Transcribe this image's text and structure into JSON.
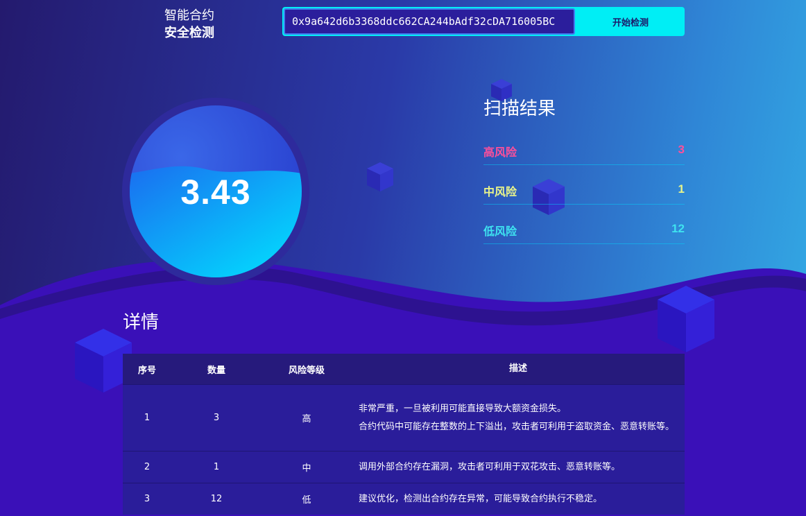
{
  "header": {
    "brand_line1": "智能合约",
    "brand_line2": "安全检测",
    "address_value": "0x9a642d6b3368ddc662CA244bAdf32cDA716005BC",
    "scan_button": "开始检测"
  },
  "score": {
    "value": "3.43"
  },
  "results": {
    "title": "扫描结果",
    "items": [
      {
        "label": "高风险",
        "count": "3",
        "color": "#ff4f9a"
      },
      {
        "label": "中风险",
        "count": "1",
        "color": "#e9f58a"
      },
      {
        "label": "低风险",
        "count": "12",
        "color": "#3ee3f0"
      }
    ]
  },
  "details": {
    "title": "详情",
    "columns": [
      "序号",
      "数量",
      "风险等级",
      "描述"
    ],
    "rows": [
      {
        "index": "1",
        "count": "3",
        "level": "高",
        "desc": [
          "非常严重，一旦被利用可能直接导致大额资金损失。",
          "合约代码中可能存在整数的上下溢出，攻击者可利用于盗取资金、恶意转账等。"
        ]
      },
      {
        "index": "2",
        "count": "1",
        "level": "中",
        "desc": [
          "调用外部合约存在漏洞，攻击者可利用于双花攻击、恶意转账等。"
        ]
      },
      {
        "index": "3",
        "count": "12",
        "level": "低",
        "desc": [
          "建议优化，检测出合约存在异常，可能导致合约执行不稳定。"
        ]
      }
    ]
  }
}
